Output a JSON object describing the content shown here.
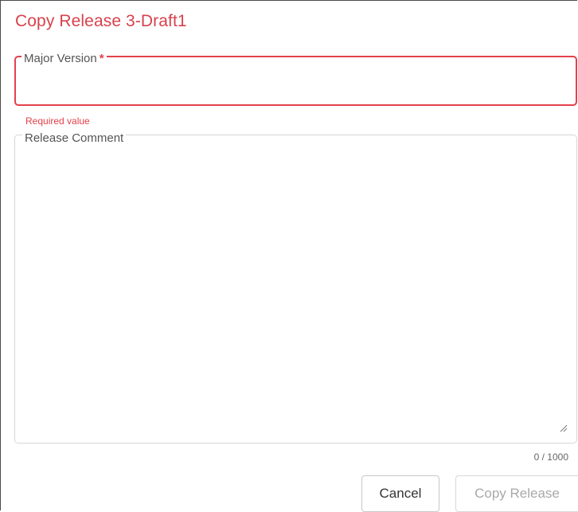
{
  "dialog": {
    "title": "Copy Release 3-Draft1"
  },
  "major_version": {
    "label": "Major Version",
    "required_marker": "*",
    "value": "",
    "error": "Required value"
  },
  "release_comment": {
    "label": "Release Comment",
    "value": "",
    "counter": "0 / 1000"
  },
  "actions": {
    "cancel_label": "Cancel",
    "copy_label": "Copy Release"
  },
  "colors": {
    "accent": "#d7424d",
    "error": "#e4414b",
    "disabled_text": "#a9a9a9"
  }
}
